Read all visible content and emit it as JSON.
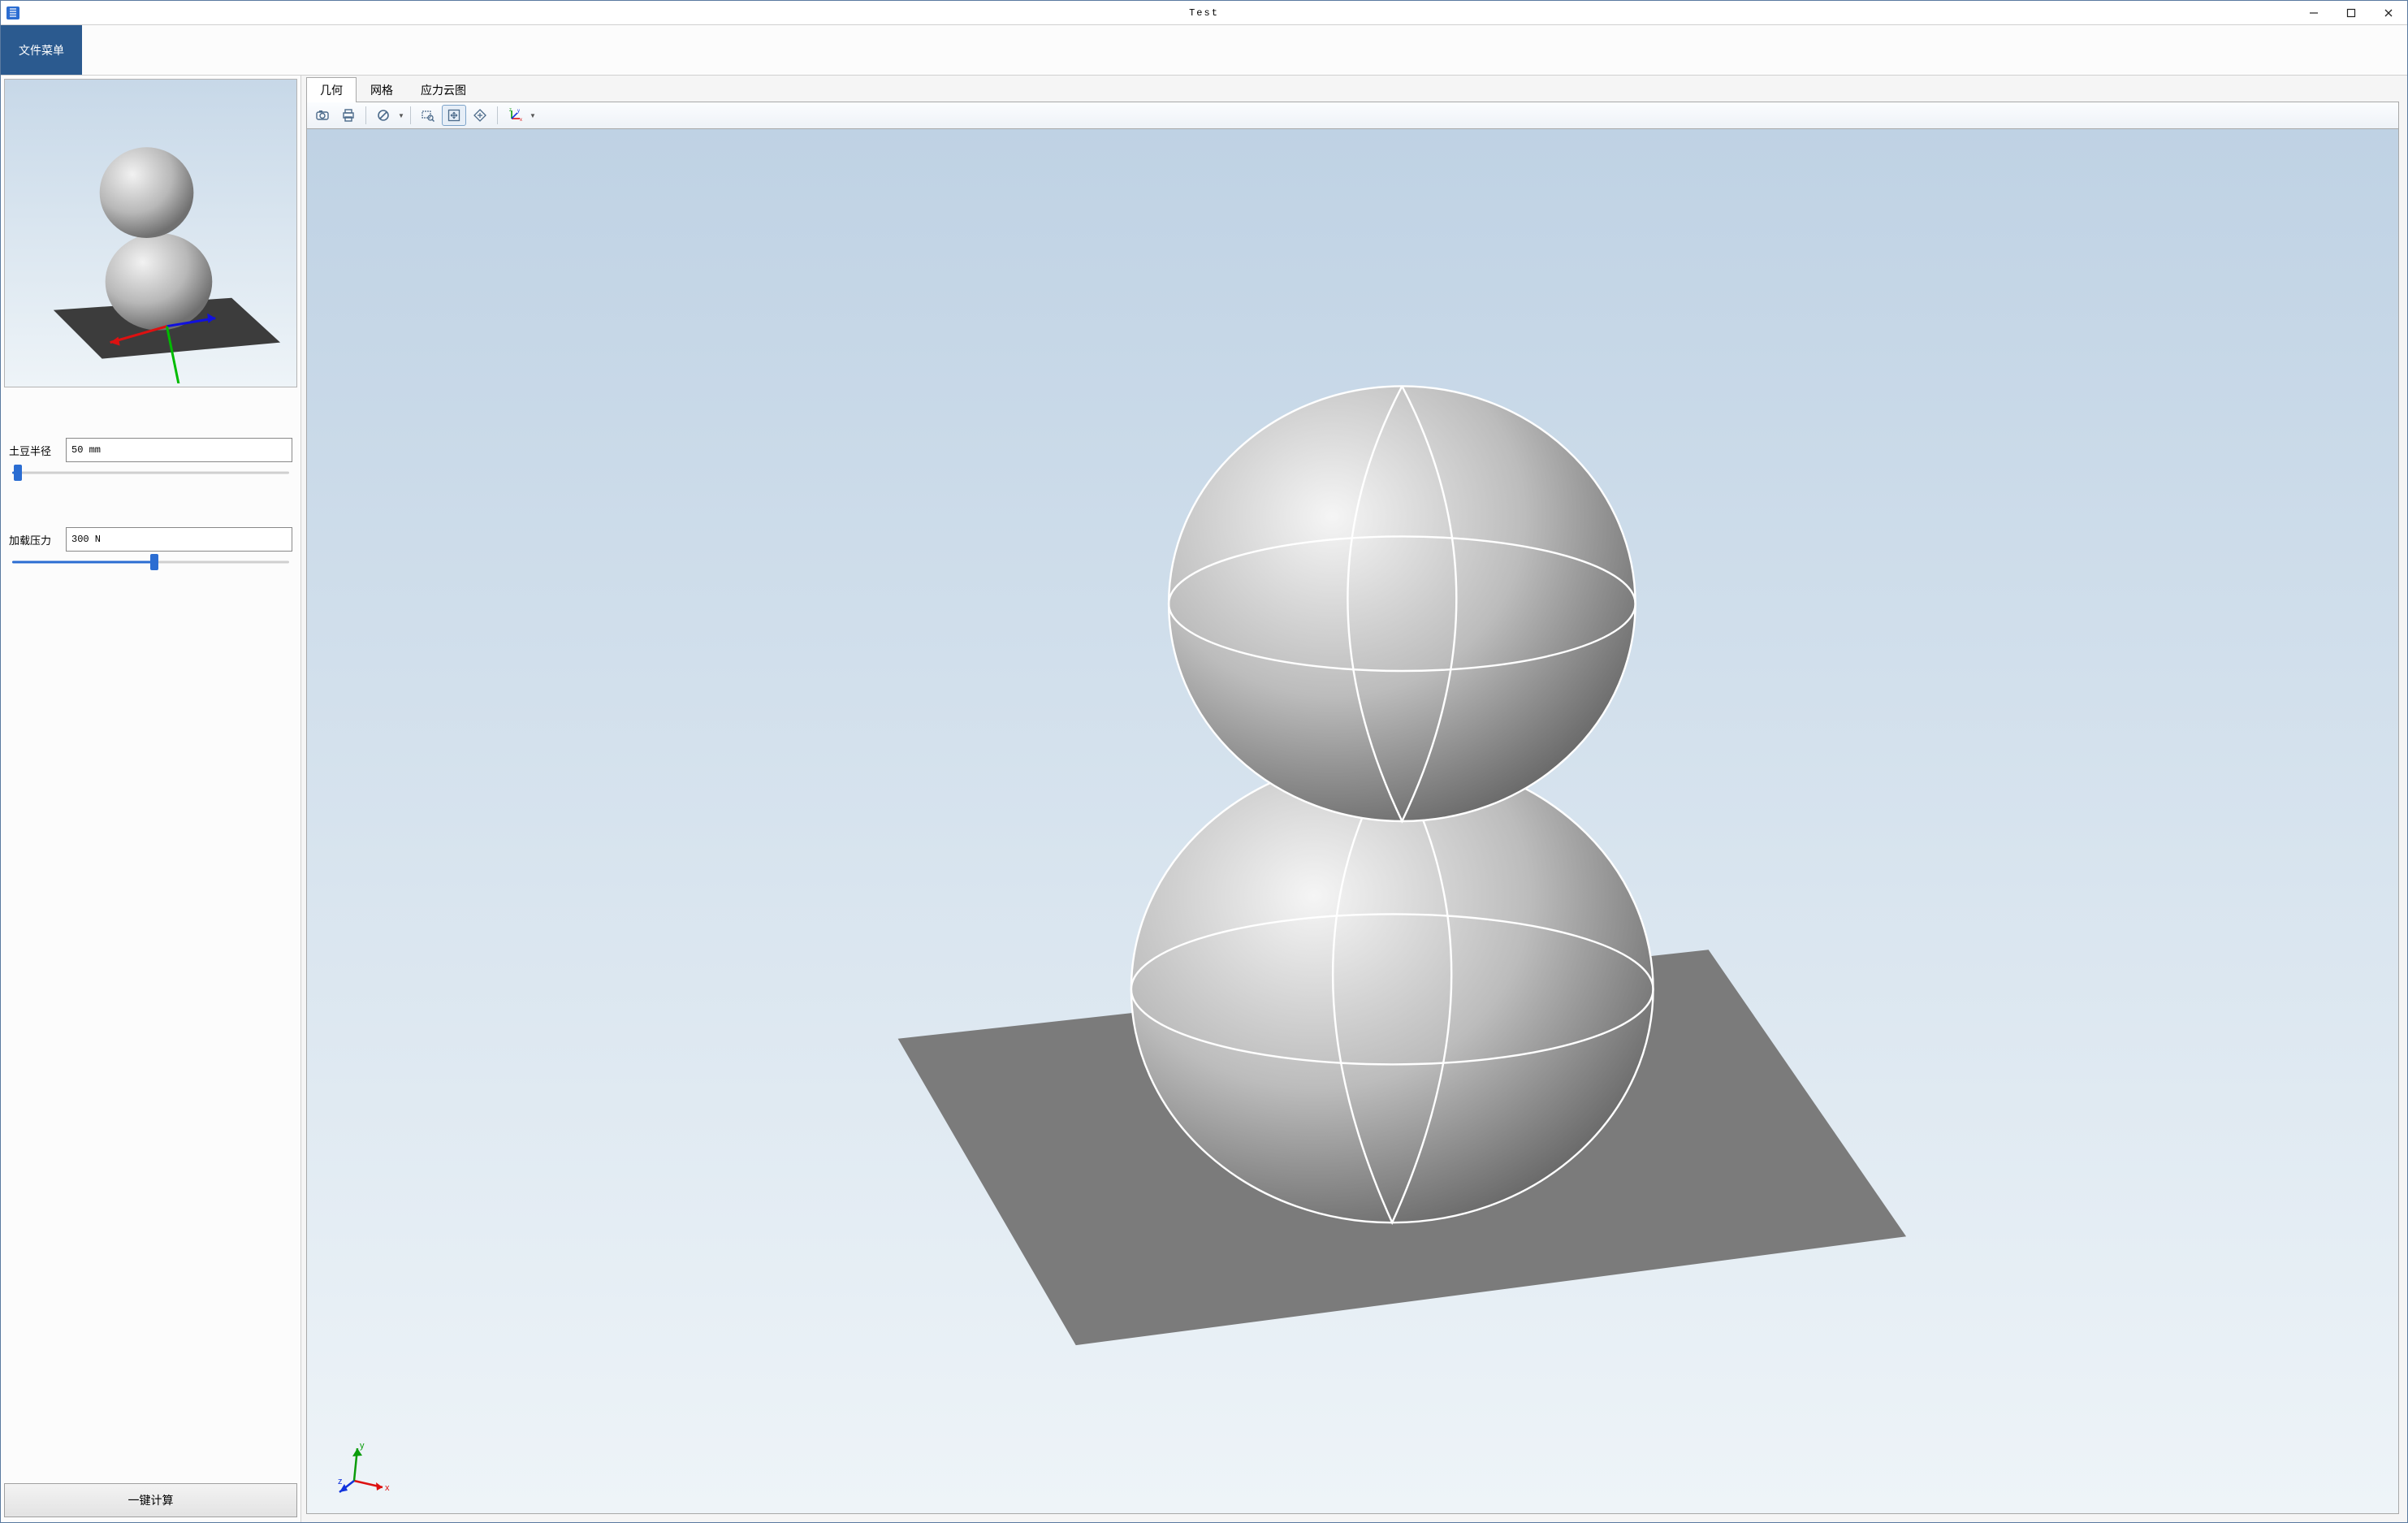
{
  "window": {
    "title": "Test"
  },
  "ribbon": {
    "file_menu_label": "文件菜单"
  },
  "sidebar": {
    "radius_label": "土豆半径",
    "radius_value": "50 mm",
    "radius_pct": 2,
    "pressure_label": "加载压力",
    "pressure_value": "300 N",
    "pressure_pct": 50,
    "compute_label": "一键计算"
  },
  "tabs": [
    {
      "id": "geom",
      "label": "几何",
      "active": true
    },
    {
      "id": "mesh",
      "label": "网格",
      "active": false
    },
    {
      "id": "stress",
      "label": "应力云图",
      "active": false
    }
  ],
  "toolbar": {
    "icons": {
      "camera": "camera-icon",
      "print": "print-icon",
      "nosign": "no-sign-icon",
      "zoomrect": "zoom-rect-icon",
      "fit": "fit-view-icon",
      "expand": "expand-icon",
      "axes": "axes-icon"
    }
  },
  "triad": {
    "x": "x",
    "y": "y",
    "z": "z"
  }
}
